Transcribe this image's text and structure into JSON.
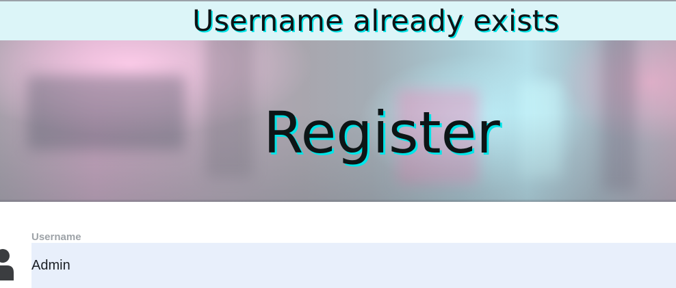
{
  "alert": {
    "message": "Username already exists",
    "background_color": "#dcf5f8",
    "text_shadow_color": "#00e5e8"
  },
  "page": {
    "title": "Register"
  },
  "form": {
    "username": {
      "label": "Username",
      "value": "Admin",
      "icon": "user-icon",
      "field_background": "#e8effb"
    }
  }
}
